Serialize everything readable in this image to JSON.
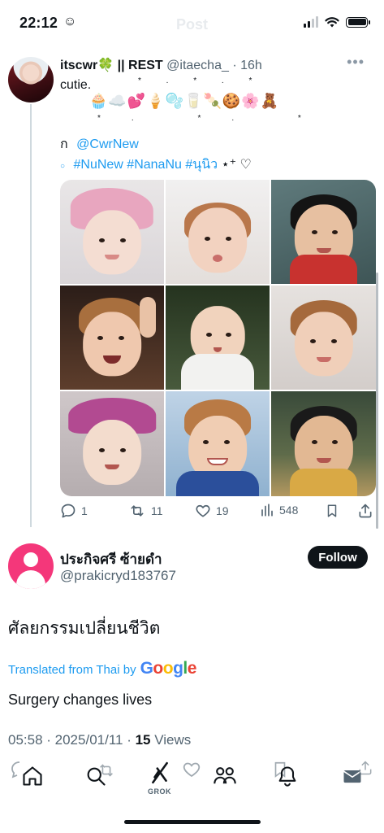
{
  "status_bar": {
    "time": "22:12",
    "status_emoji": "☺"
  },
  "header": {
    "title": "Post"
  },
  "quoted_post": {
    "name": "itscwr🍀 || REST",
    "handle": "@itaecha_",
    "time": "16h",
    "text": "cutie.",
    "emoji_line": "🧁☁️💕🍦🫧🥛🍡🍪🌸🧸",
    "mention_symbol": "ก",
    "mention": "@CwrNew",
    "hashtags": "#NuNew #NanaNu #นุนิว",
    "tag_suffix": "⋆⁺ ♡",
    "photo_count": 9,
    "stats": {
      "replies": "1",
      "reposts": "11",
      "likes": "19",
      "views": "548"
    }
  },
  "main_post": {
    "name": "ประกิจศรี ซ้ายดำ",
    "handle": "@prakicryd183767",
    "follow_label": "Follow",
    "text": "ศัลยกรรมเปลี่ยนชีวิต",
    "translated_prefix": "Translated from Thai by",
    "translator": "Google",
    "translation": "Surgery changes lives",
    "timestamp": "05:58 · 2025/01/11 ·",
    "views_count": "15",
    "views_label": "Views"
  },
  "tabbar": {
    "grok_label": "GROK",
    "icons": [
      "home-icon",
      "search-icon",
      "grok-icon",
      "communities-icon",
      "notifications-icon",
      "messages-icon"
    ]
  },
  "colors": {
    "accent": "#1d9bf0",
    "text": "#0f1419",
    "secondary": "#536471",
    "avatar_pink": "#f4377a"
  }
}
